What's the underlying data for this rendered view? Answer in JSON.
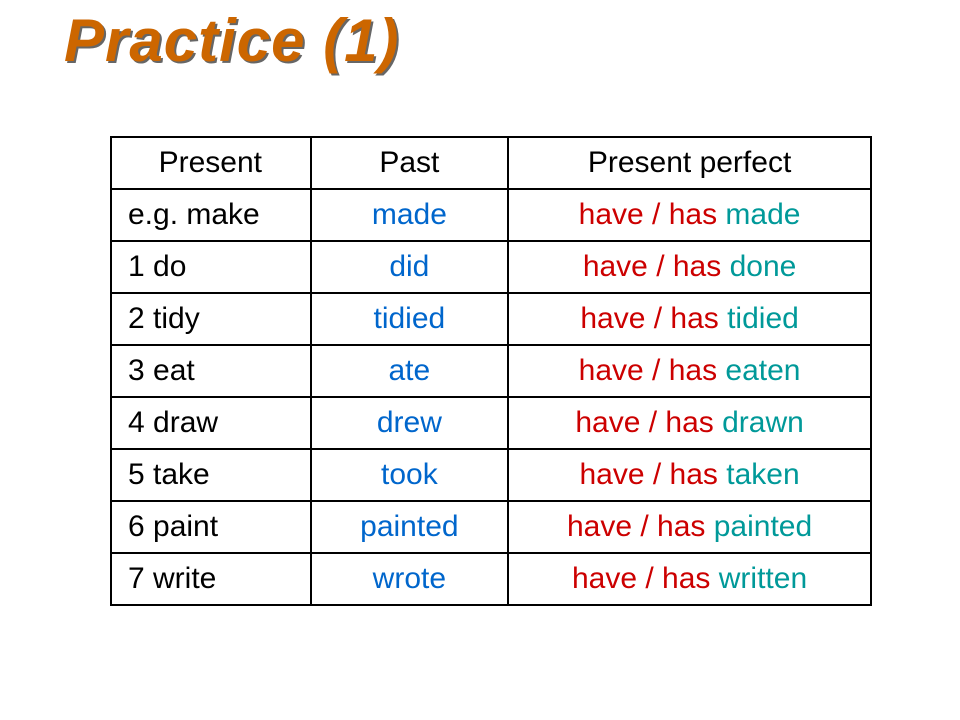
{
  "title": "Practice (1)",
  "headers": {
    "present": "Present",
    "past": "Past",
    "pp": "Present perfect"
  },
  "rows": [
    {
      "present": "e.g. make",
      "past": "made",
      "aux": "have / has ",
      "ppart": "made"
    },
    {
      "present": "1  do",
      "past": "did",
      "aux": "have / has ",
      "ppart": "done"
    },
    {
      "present": "2  tidy",
      "past": "tidied",
      "aux": "have / has ",
      "ppart": "tidied"
    },
    {
      "present": "3  eat",
      "past": "ate",
      "aux": "have / has ",
      "ppart": "eaten"
    },
    {
      "present": "4  draw",
      "past": "drew",
      "aux": "have / has ",
      "ppart": "drawn"
    },
    {
      "present": "5  take",
      "past": "took",
      "aux": "have / has ",
      "ppart": "taken"
    },
    {
      "present": "6  paint",
      "past": "painted",
      "aux": "have / has ",
      "ppart": "painted"
    },
    {
      "present": "7  write",
      "past": "wrote",
      "aux": "have / has ",
      "ppart": "written"
    }
  ],
  "chart_data": {
    "type": "table",
    "title": "Practice (1)",
    "columns": [
      "Present",
      "Past",
      "Present perfect"
    ],
    "rows": [
      [
        "e.g. make",
        "made",
        "have / has made"
      ],
      [
        "1 do",
        "did",
        "have / has done"
      ],
      [
        "2 tidy",
        "tidied",
        "have / has tidied"
      ],
      [
        "3 eat",
        "ate",
        "have / has eaten"
      ],
      [
        "4 draw",
        "drew",
        "have / has drawn"
      ],
      [
        "5 take",
        "took",
        "have / has taken"
      ],
      [
        "6 paint",
        "painted",
        "have / has painted"
      ],
      [
        "7 write",
        "wrote",
        "have / has written"
      ]
    ]
  }
}
